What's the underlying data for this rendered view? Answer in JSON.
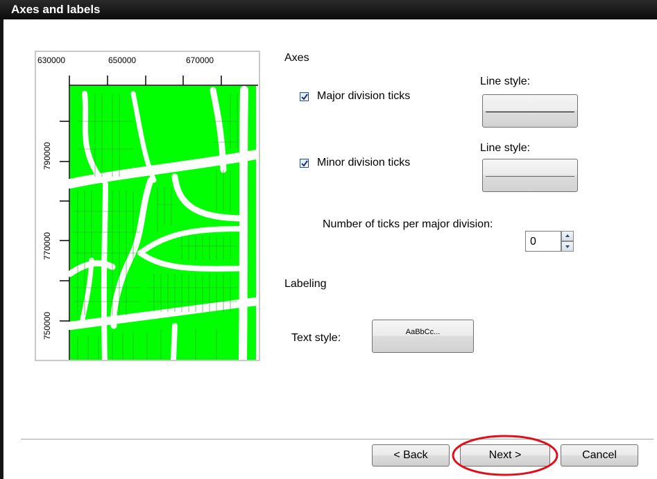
{
  "window": {
    "title": "Axes and labels"
  },
  "preview": {
    "top_ticks": [
      "630000",
      "650000",
      "670000"
    ],
    "left_ticks": [
      "790000",
      "770000",
      "750000"
    ],
    "map_fill_color": "#00ff00",
    "road_color": "#ffffff"
  },
  "axes": {
    "heading": "Axes",
    "major": {
      "label": "Major division ticks",
      "checked": true,
      "line_style_label": "Line style:"
    },
    "minor": {
      "label": "Minor division ticks",
      "checked": true,
      "line_style_label": "Line style:"
    },
    "ticks_per_major_label": "Number of ticks per major division:",
    "ticks_per_major_value": "0"
  },
  "labeling": {
    "heading": "Labeling",
    "text_style_label": "Text style:",
    "text_style_sample": "AaBbCc..."
  },
  "buttons": {
    "back": "< Back",
    "next": "Next >",
    "cancel": "Cancel"
  },
  "colors": {
    "highlight_ellipse": "#e0101a",
    "checkbox_check": "#1c2f80"
  }
}
